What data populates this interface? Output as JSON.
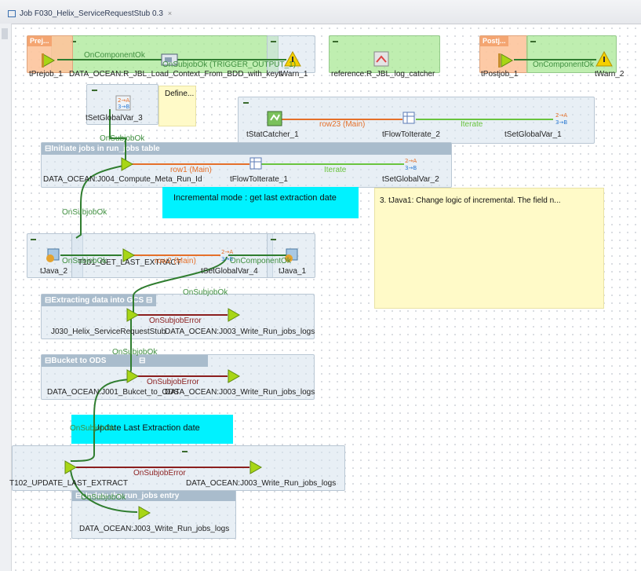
{
  "window": {
    "tab_title": "Job F030_Helix_ServiceRequestStub 0.3",
    "tab_close": "×"
  },
  "subjobs": {
    "prejob": "Prej...",
    "postjob": "Postj...",
    "initiate": "Initiate jobs in run_jobs table",
    "extracting": "Extracting data into GCS",
    "bucket": "Bucket to ODS",
    "update": "Update the run_jobs entry"
  },
  "components": {
    "tPrejob": "tPrejob_1",
    "load_context": "DATA_OCEAN:R_JBL_Load_Context_From_BDD_with_keys",
    "tWarn1": "tWarn_1",
    "log_catcher": "reference:R_JBL_log_catcher",
    "tPostjob": "tPostjob_1",
    "tWarn2": "tWarn_2",
    "tSetGlobalVar3": "tSetGlobalVar_3",
    "tStatCatcher": "tStatCatcher_1",
    "tFlowToIterate2": "tFlowToIterate_2",
    "tSetGlobalVar1": "tSetGlobalVar_1",
    "compute_meta": "DATA_OCEAN:J004_Compute_Meta_Run_Id",
    "tFlowToIterate1": "tFlowToIterate_1",
    "tSetGlobalVar2": "tSetGlobalVar_2",
    "tJava2": "tJava_2",
    "t101": "T101_GET_LAST_EXTRACT",
    "tSetGlobalVar4": "tSetGlobalVar_4",
    "tJava1": "tJava_1",
    "j030": "J030_Helix_ServiceRequestStub",
    "write_logs_1": "DATA_OCEAN:J003_Write_Run_jobs_logs",
    "j001": "DATA_OCEAN:J001_Bukcet_to_ODS",
    "write_logs_2": "DATA_OCEAN:J003_Write_Run_jobs_logs",
    "t102": "T102_UPDATE_LAST_EXTRACT",
    "write_logs_3": "DATA_OCEAN:J003_Write_Run_jobs_logs",
    "write_logs_4": "DATA_OCEAN:J003_Write_Run_jobs_logs"
  },
  "links": {
    "oncomponentok_1": "OnComponentOk",
    "onsubjobok_trigger": "OnSubjobOk (TRIGGER_OUTPUT_1)",
    "oncomponentok_2": "OnComponentOk",
    "row23": "row23 (Main)",
    "iterate_1": "Iterate",
    "onsubjobok_1": "OnSubjobOk",
    "row1": "row1 (Main)",
    "iterate_2": "Iterate",
    "onsubjobok_2": "OnSubjobOk",
    "onsubjobok_3": "OnSubjobOk",
    "row2": "row2 (Main)",
    "oncomponentok_3": "OnComponentOk",
    "onsubjobok_4": "OnSubjobOk",
    "onsubjoberror_1": "OnSubjobError",
    "onsubjobok_5": "OnSubjobOk",
    "onsubjoberror_2": "OnSubjobError",
    "onsubjobok_6": "OnSubjobOk",
    "onsubjoberror_3": "OnSubjobError",
    "onsubjobok_7": "OnSubjobOk"
  },
  "notes": {
    "define": "Define...",
    "incremental_mode": "Incremental mode : get last extraction date",
    "tjava1_note": "3. tJava1: Change logic of incremental. The field n...",
    "update_last": "Update Last Extraction date"
  },
  "colors": {
    "main_link": "#e5702a",
    "ok_link": "#2f7d2f",
    "error_link": "#8b1e1e",
    "iterate": "#6ac43f",
    "note_yellow": "#fffac8",
    "note_cyan": "#00f2ff"
  }
}
